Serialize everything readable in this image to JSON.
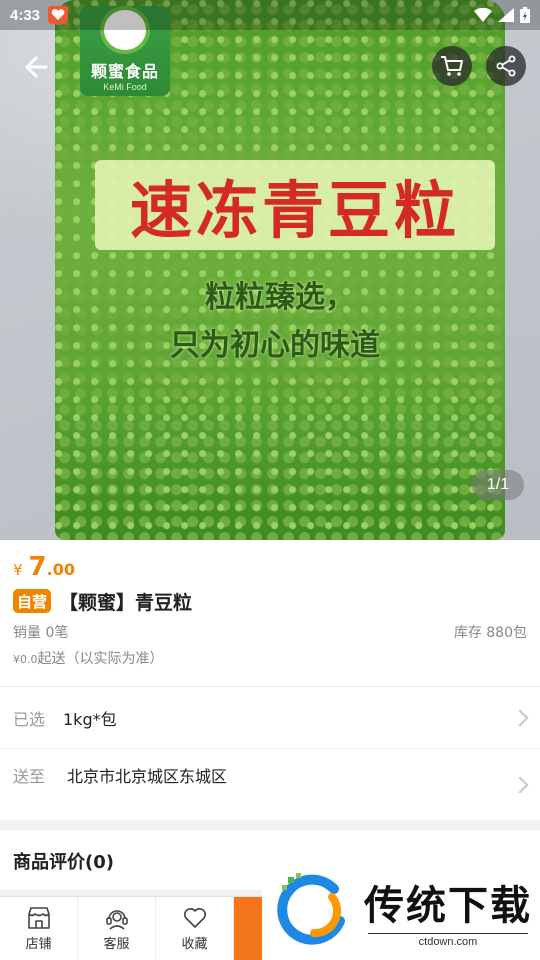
{
  "status_bar": {
    "time": "4:33"
  },
  "hero": {
    "brand_name": "颗蜜食品",
    "brand_sub": "KeMi Food",
    "package_title": "速冻青豆粒",
    "slogan_line1": "粒粒臻选，",
    "slogan_line2": "只为初心的味道",
    "page_indicator": "1/1"
  },
  "product": {
    "price_symbol": "¥",
    "price_int": "7",
    "price_dec": ".00",
    "self_tag": "自营",
    "title": "【颗蜜】青豆粒",
    "sales": "销量 0笔",
    "stock": "库存 880包",
    "shipping_amount": "¥0.0",
    "shipping_text": "起送（以实际为准）"
  },
  "options": {
    "selected_label": "已选",
    "selected_value": "1kg*包",
    "deliver_label": "送至",
    "deliver_value": "北京市北京城区东城区"
  },
  "reviews": {
    "title": "商品评价(0)"
  },
  "bottom_bar": {
    "store_label": "店铺",
    "service_label": "客服",
    "favorite_label": "收藏"
  },
  "watermark": {
    "text": "传统下载",
    "url": "ctdown.com"
  },
  "colors": {
    "accent": "#f08300",
    "tag": "#f08300",
    "cta": "#f5761a"
  }
}
